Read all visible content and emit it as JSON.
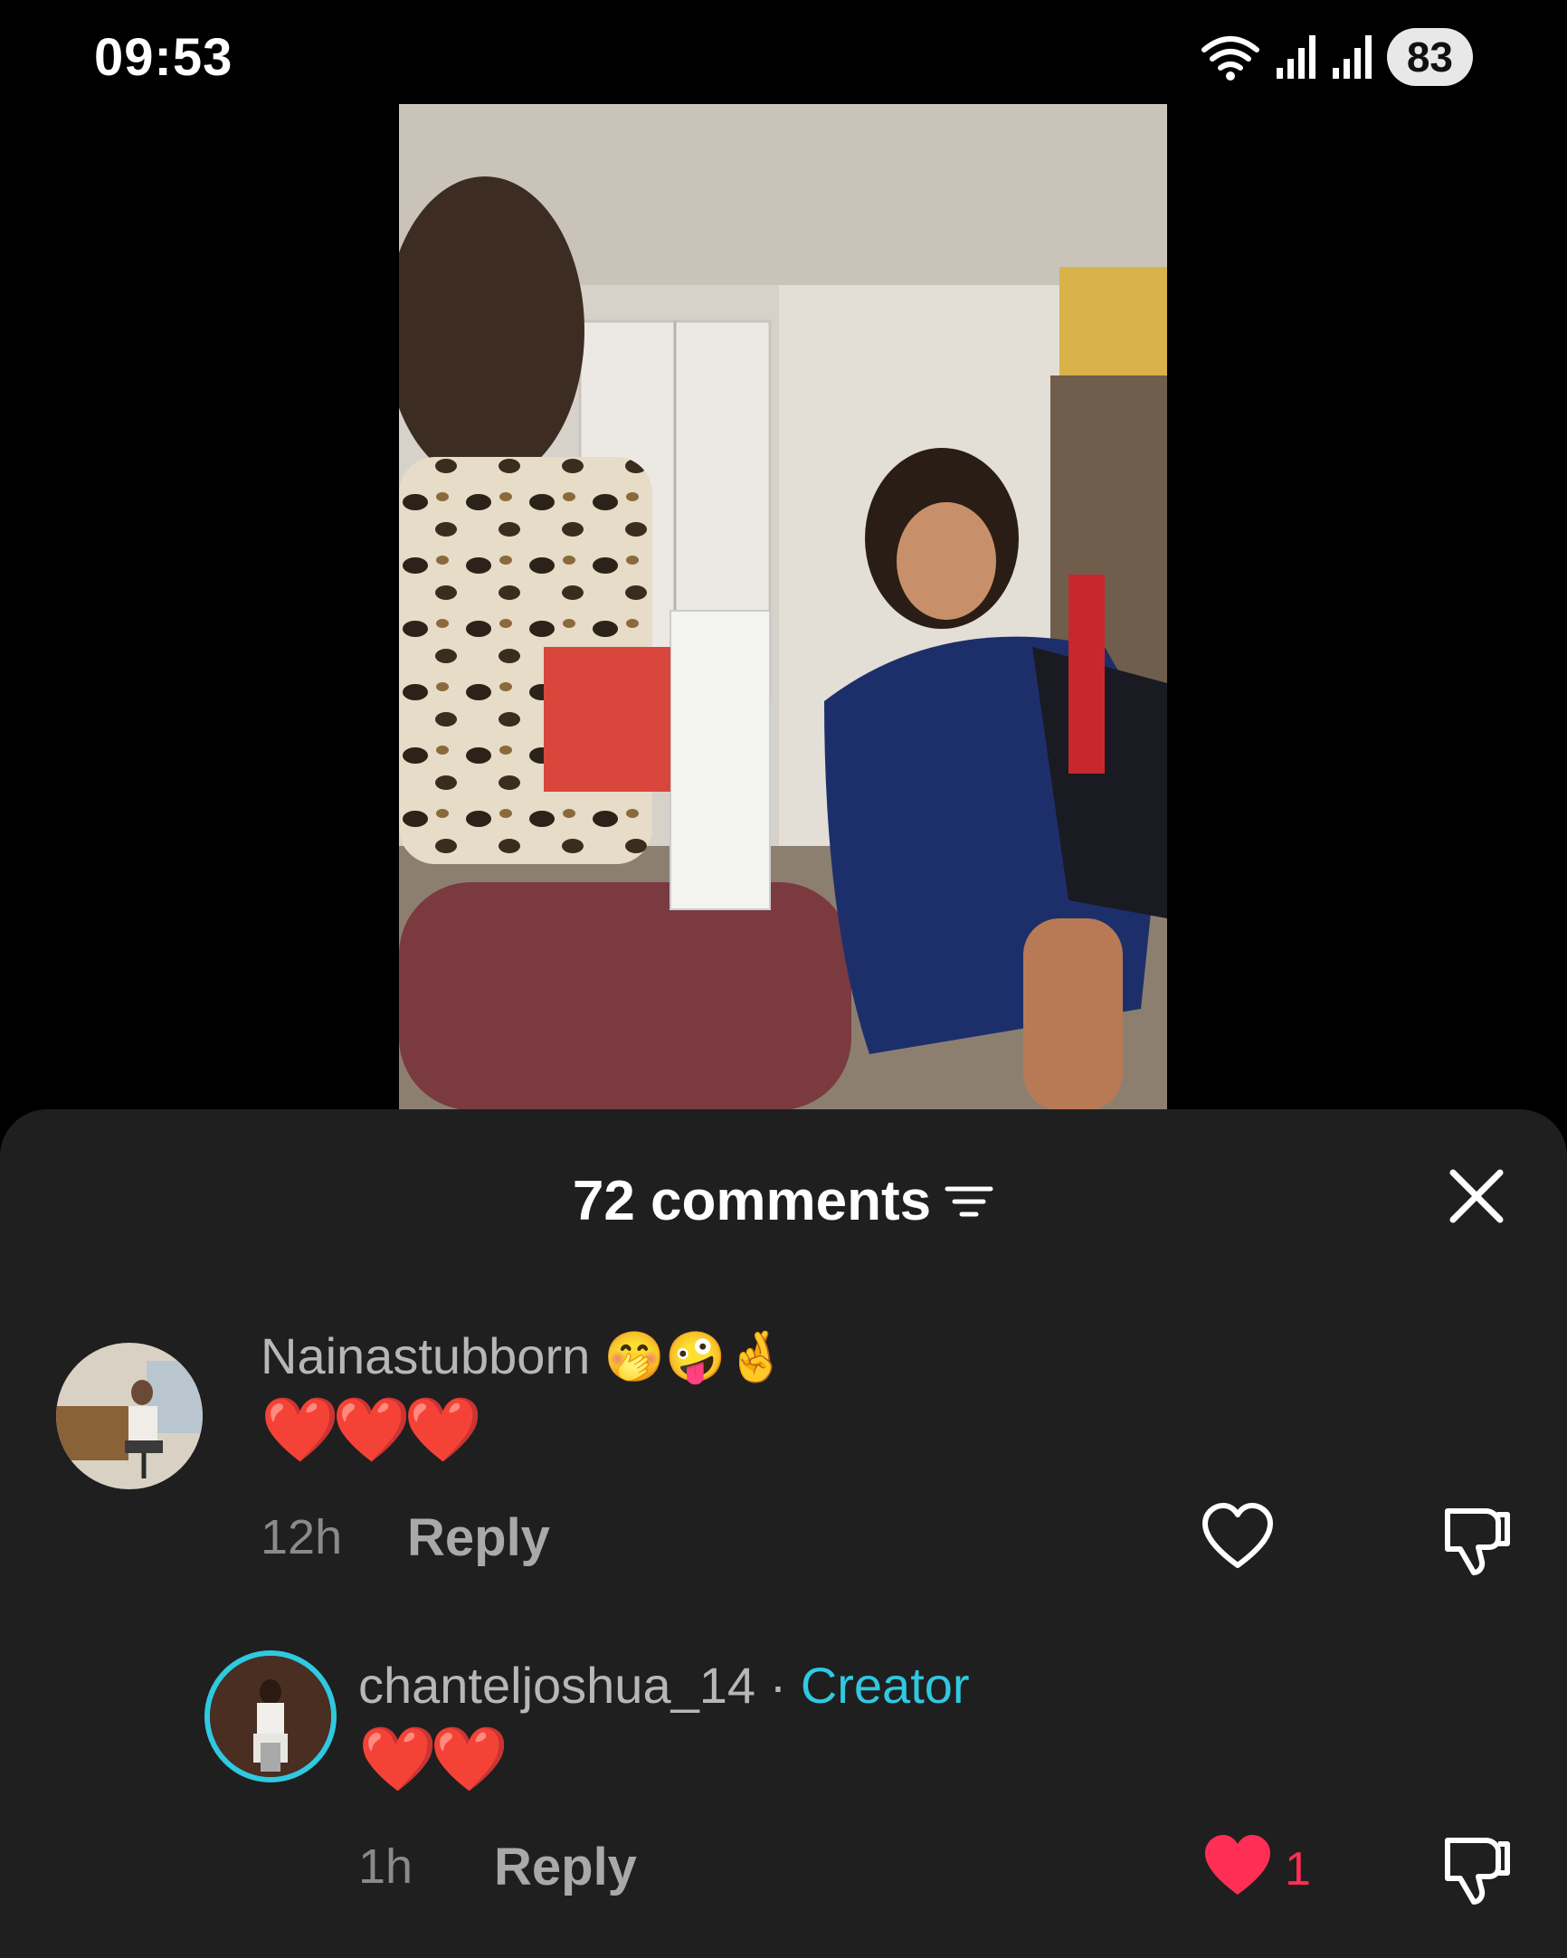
{
  "status_bar": {
    "time": "09:53",
    "battery": "83",
    "icons": [
      "wifi-icon",
      "signal-icon",
      "signal-icon"
    ]
  },
  "video": {
    "description_icon": "video-frame"
  },
  "comments_panel": {
    "title": "72 comments",
    "sort_icon": "sort-icon",
    "close_icon": "close-icon",
    "comments": [
      {
        "username": "Nainastubborn",
        "username_emoji": "🤭🤪🤞",
        "text": "❤️❤️❤️",
        "time": "12h",
        "reply_label": "Reply",
        "liked": false
      }
    ],
    "replies": [
      {
        "username": "chanteljoshua_14",
        "separator": "·",
        "badge": "Creator",
        "text": "❤️❤️",
        "time": "1h",
        "reply_label": "Reply",
        "liked": true,
        "like_count": "1"
      }
    ]
  },
  "colors": {
    "sheet_bg": "#1f1f1f",
    "creator_accent": "#2fc9e0",
    "like_red": "#ff2e55"
  }
}
